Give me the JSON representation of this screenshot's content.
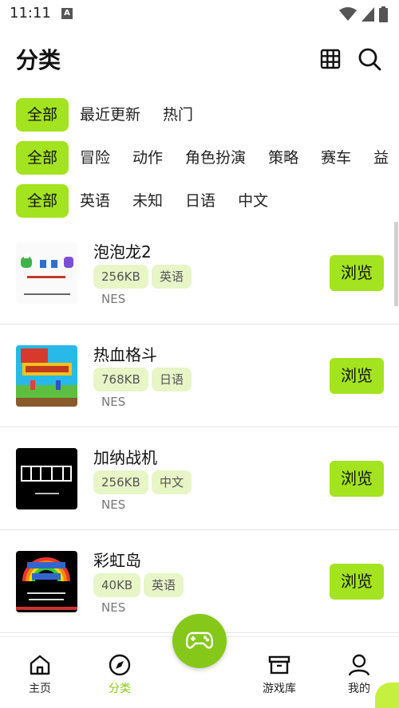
{
  "status_bar": {
    "time": "11:11",
    "notice_glyph": "A"
  },
  "header": {
    "title": "分类"
  },
  "filters": {
    "sort": [
      {
        "label": "全部",
        "active": true
      },
      {
        "label": "最近更新"
      },
      {
        "label": "热门"
      }
    ],
    "genre": [
      {
        "label": "全部",
        "active": true
      },
      {
        "label": "冒险"
      },
      {
        "label": "动作"
      },
      {
        "label": "角色扮演"
      },
      {
        "label": "策略"
      },
      {
        "label": "赛车"
      },
      {
        "label": "益"
      }
    ],
    "language": [
      {
        "label": "全部",
        "active": true
      },
      {
        "label": "英语"
      },
      {
        "label": "未知"
      },
      {
        "label": "日语"
      },
      {
        "label": "中文"
      }
    ]
  },
  "games": [
    {
      "title": "泡泡龙2",
      "size": "256KB",
      "language": "英语",
      "platform": "NES",
      "action": "浏览"
    },
    {
      "title": "热血格斗",
      "size": "768KB",
      "language": "日语",
      "platform": "NES",
      "action": "浏览"
    },
    {
      "title": "加纳战机",
      "size": "256KB",
      "language": "中文",
      "platform": "NES",
      "action": "浏览"
    },
    {
      "title": "彩虹岛",
      "size": "40KB",
      "language": "英语",
      "platform": "NES",
      "action": "浏览"
    }
  ],
  "bottom_nav": [
    {
      "label": "主页",
      "icon": "home-icon"
    },
    {
      "label": "分类",
      "icon": "compass-icon",
      "active": true
    },
    {
      "label": "游戏库",
      "icon": "archive-box-icon"
    },
    {
      "label": "我的",
      "icon": "user-icon"
    }
  ],
  "colors": {
    "accent": "#a3e31f",
    "tag_bg": "#e7f5c7",
    "fab": "#86c81a",
    "nav_active": "#8cc816"
  }
}
